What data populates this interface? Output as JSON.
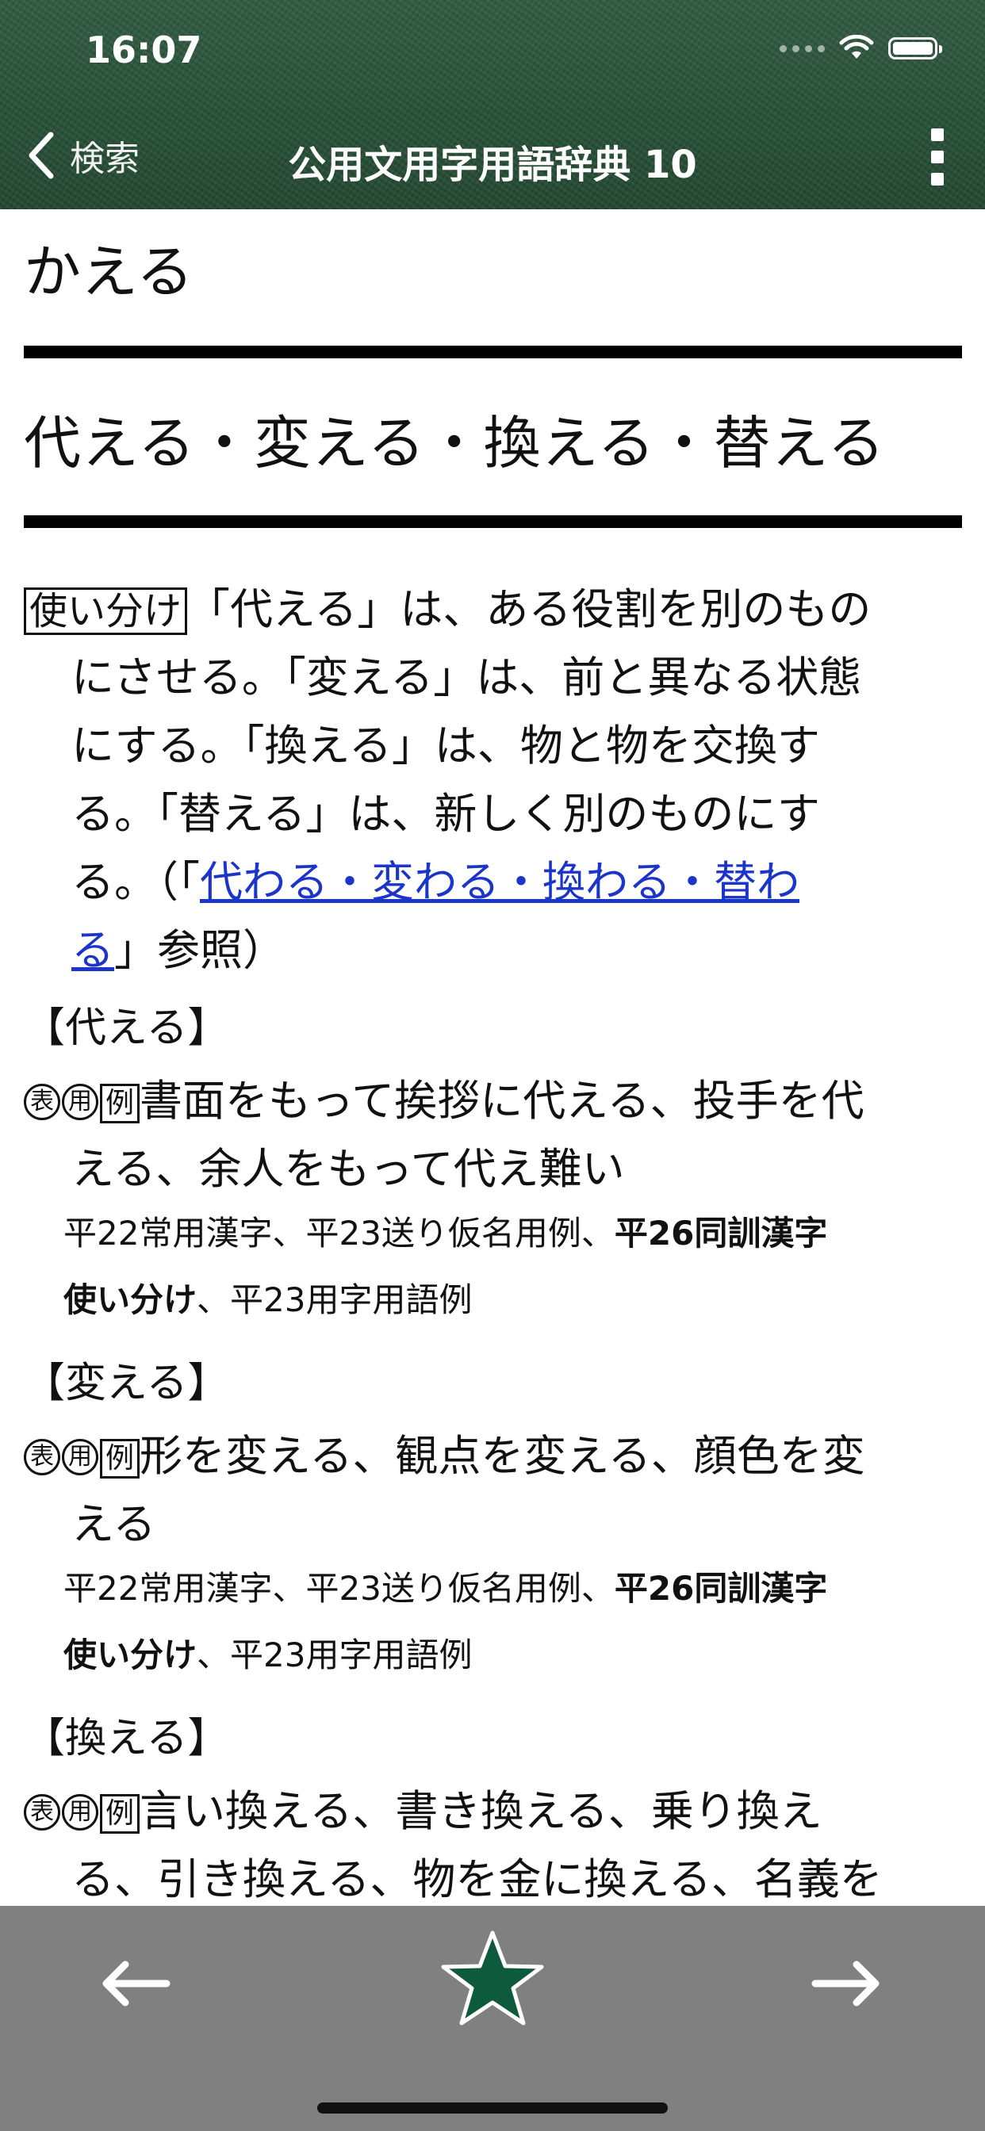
{
  "status_bar": {
    "time": "16:07"
  },
  "nav": {
    "back_label": "検索",
    "title": "公用文用字用語辞典 10"
  },
  "entry": {
    "reading": "かえる",
    "headword": "代える・変える・換える・替える",
    "usage_label": "使い分け",
    "usage_line1": "「代える」は、ある役割を別のもの",
    "usage_line2": "にさせる。「変える」は、前と異なる状態",
    "usage_line3": "にする。「換える」は、物と物を交換す",
    "usage_line4": "る。「替える」は、新しく別のものにす",
    "usage_line5_pre": "る。（「",
    "usage_link_a": "代わる・変わる・換わる・替わ",
    "usage_link_b": "る",
    "usage_line6_post": "」参照）",
    "mark_hyo": "表",
    "mark_yo": "用",
    "mark_rei": "例",
    "sections": [
      {
        "title": "【代える】",
        "example_line1": "書面をもって挨拶に代える、投手を代",
        "example_line2": "える、余人をもって代え難い",
        "src_a": "平22常用漢字、平23送り仮名用例、",
        "src_bold": "平26同訓漢字",
        "src_bold2": "使い分け",
        "src_b": "、平23用字用語例"
      },
      {
        "title": "【変える】",
        "example_line1": "形を変える、観点を変える、顔色を変",
        "example_line2": "える",
        "src_a": "平22常用漢字、平23送り仮名用例、",
        "src_bold": "平26同訓漢字",
        "src_bold2": "使い分け",
        "src_b": "、平23用字用語例"
      },
      {
        "title": "【換える】",
        "example_line1": "言い換える、書き換える、乗り換え",
        "example_line2": "る、引き換える、物を金に換える、名義を"
      }
    ]
  },
  "toolbar": {
    "prev": "prev-arrow",
    "favorite": "star-icon",
    "next": "next-arrow",
    "star_color": "#0e5a3c"
  }
}
